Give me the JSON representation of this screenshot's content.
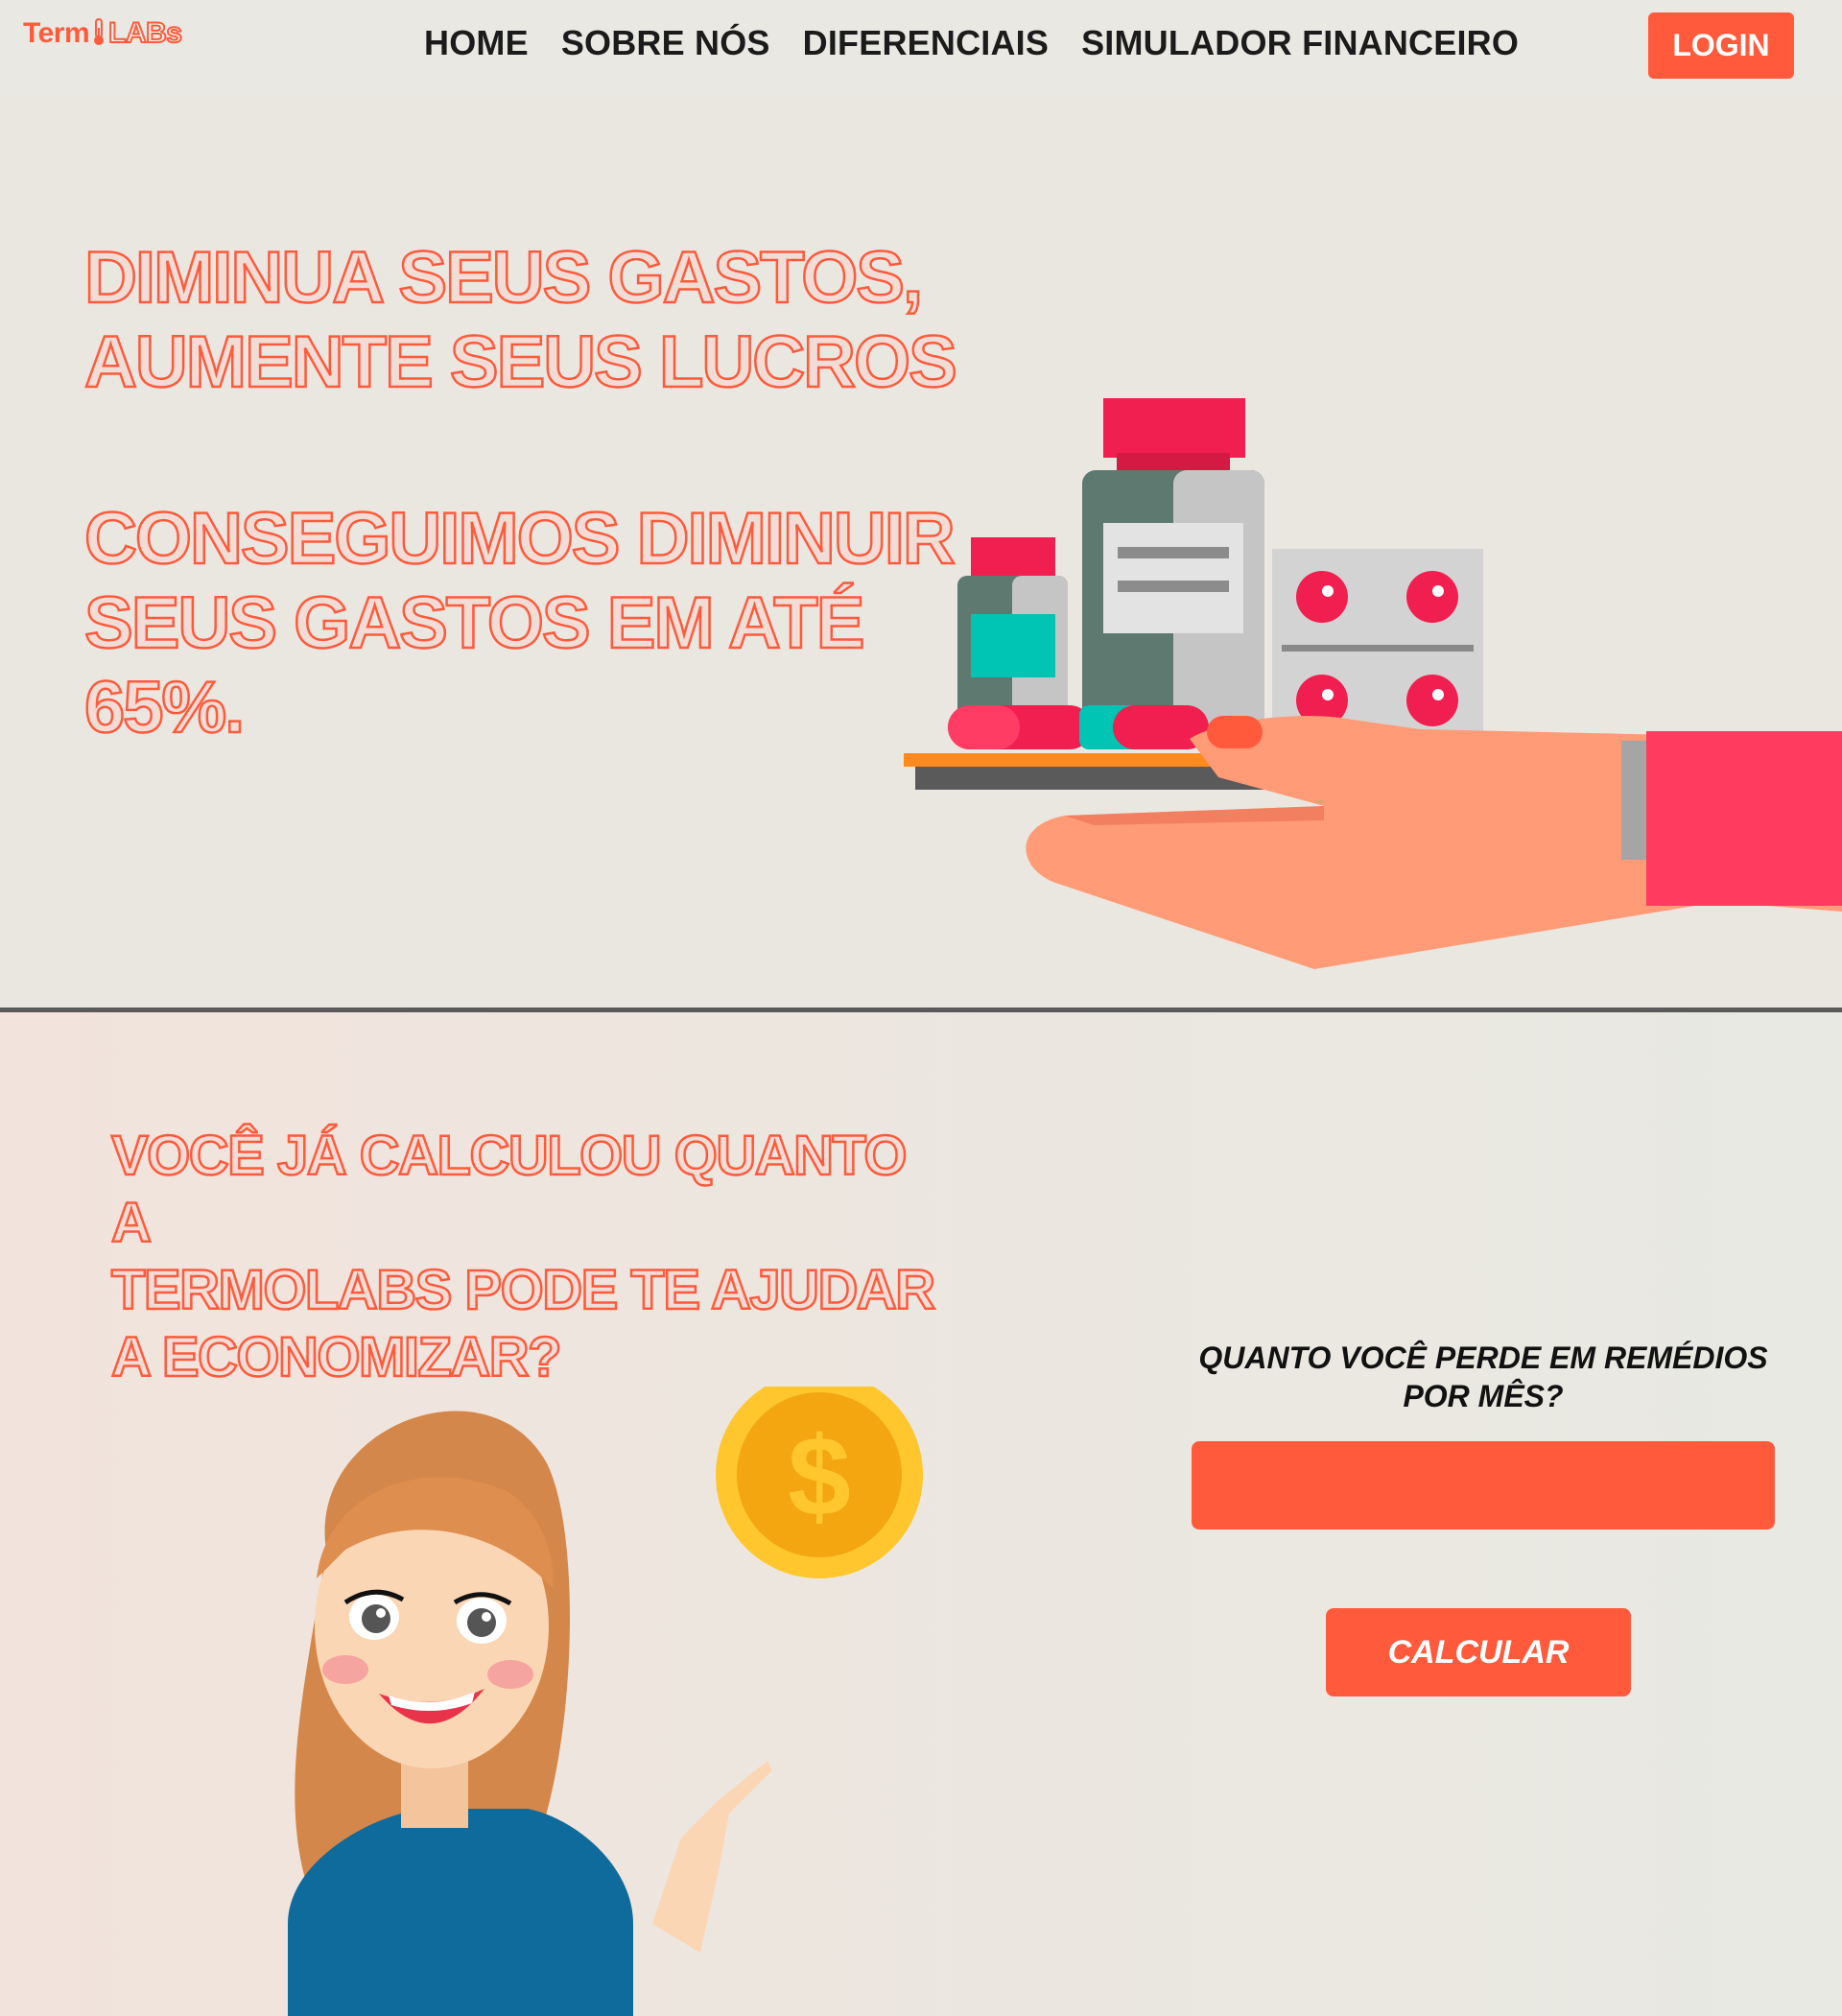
{
  "header": {
    "logo_part1": "Term",
    "logo_part2": "LABs",
    "nav": [
      {
        "label": "HOME"
      },
      {
        "label": "SOBRE NÓS"
      },
      {
        "label": "DIFERENCIAIS"
      },
      {
        "label": "SIMULADOR FINANCEIRO"
      }
    ],
    "login_label": "LOGIN"
  },
  "hero": {
    "title_line1": "DIMINUA SEUS GASTOS,",
    "title_line2": "AUMENTE SEUS LUCROS",
    "sub_line1": "CONSEGUIMOS DIMINUIR",
    "sub_line2": "SEUS GASTOS EM ATÉ",
    "sub_line3": "65%.",
    "illustration_icon": "hand-holding-medicine-icon"
  },
  "calculator": {
    "title_line1": "VOCÊ JÁ CALCULOU QUANTO A",
    "title_line2": "TERMOLABS PODE TE AJUDAR",
    "title_line3": "A ECONOMIZAR?",
    "question_line1": "QUANTO VOCÊ PERDE EM REMÉDIOS",
    "question_line2": "POR MÊS?",
    "input_value": "",
    "input_placeholder": "",
    "button_label": "CALCULAR",
    "illustration_icon": "woman-pointing-coin-icon"
  },
  "colors": {
    "accent": "#ff5a3c",
    "background": "#e9e8e2",
    "text_dark": "#1b1b1b",
    "divider": "#5a5a5a"
  }
}
